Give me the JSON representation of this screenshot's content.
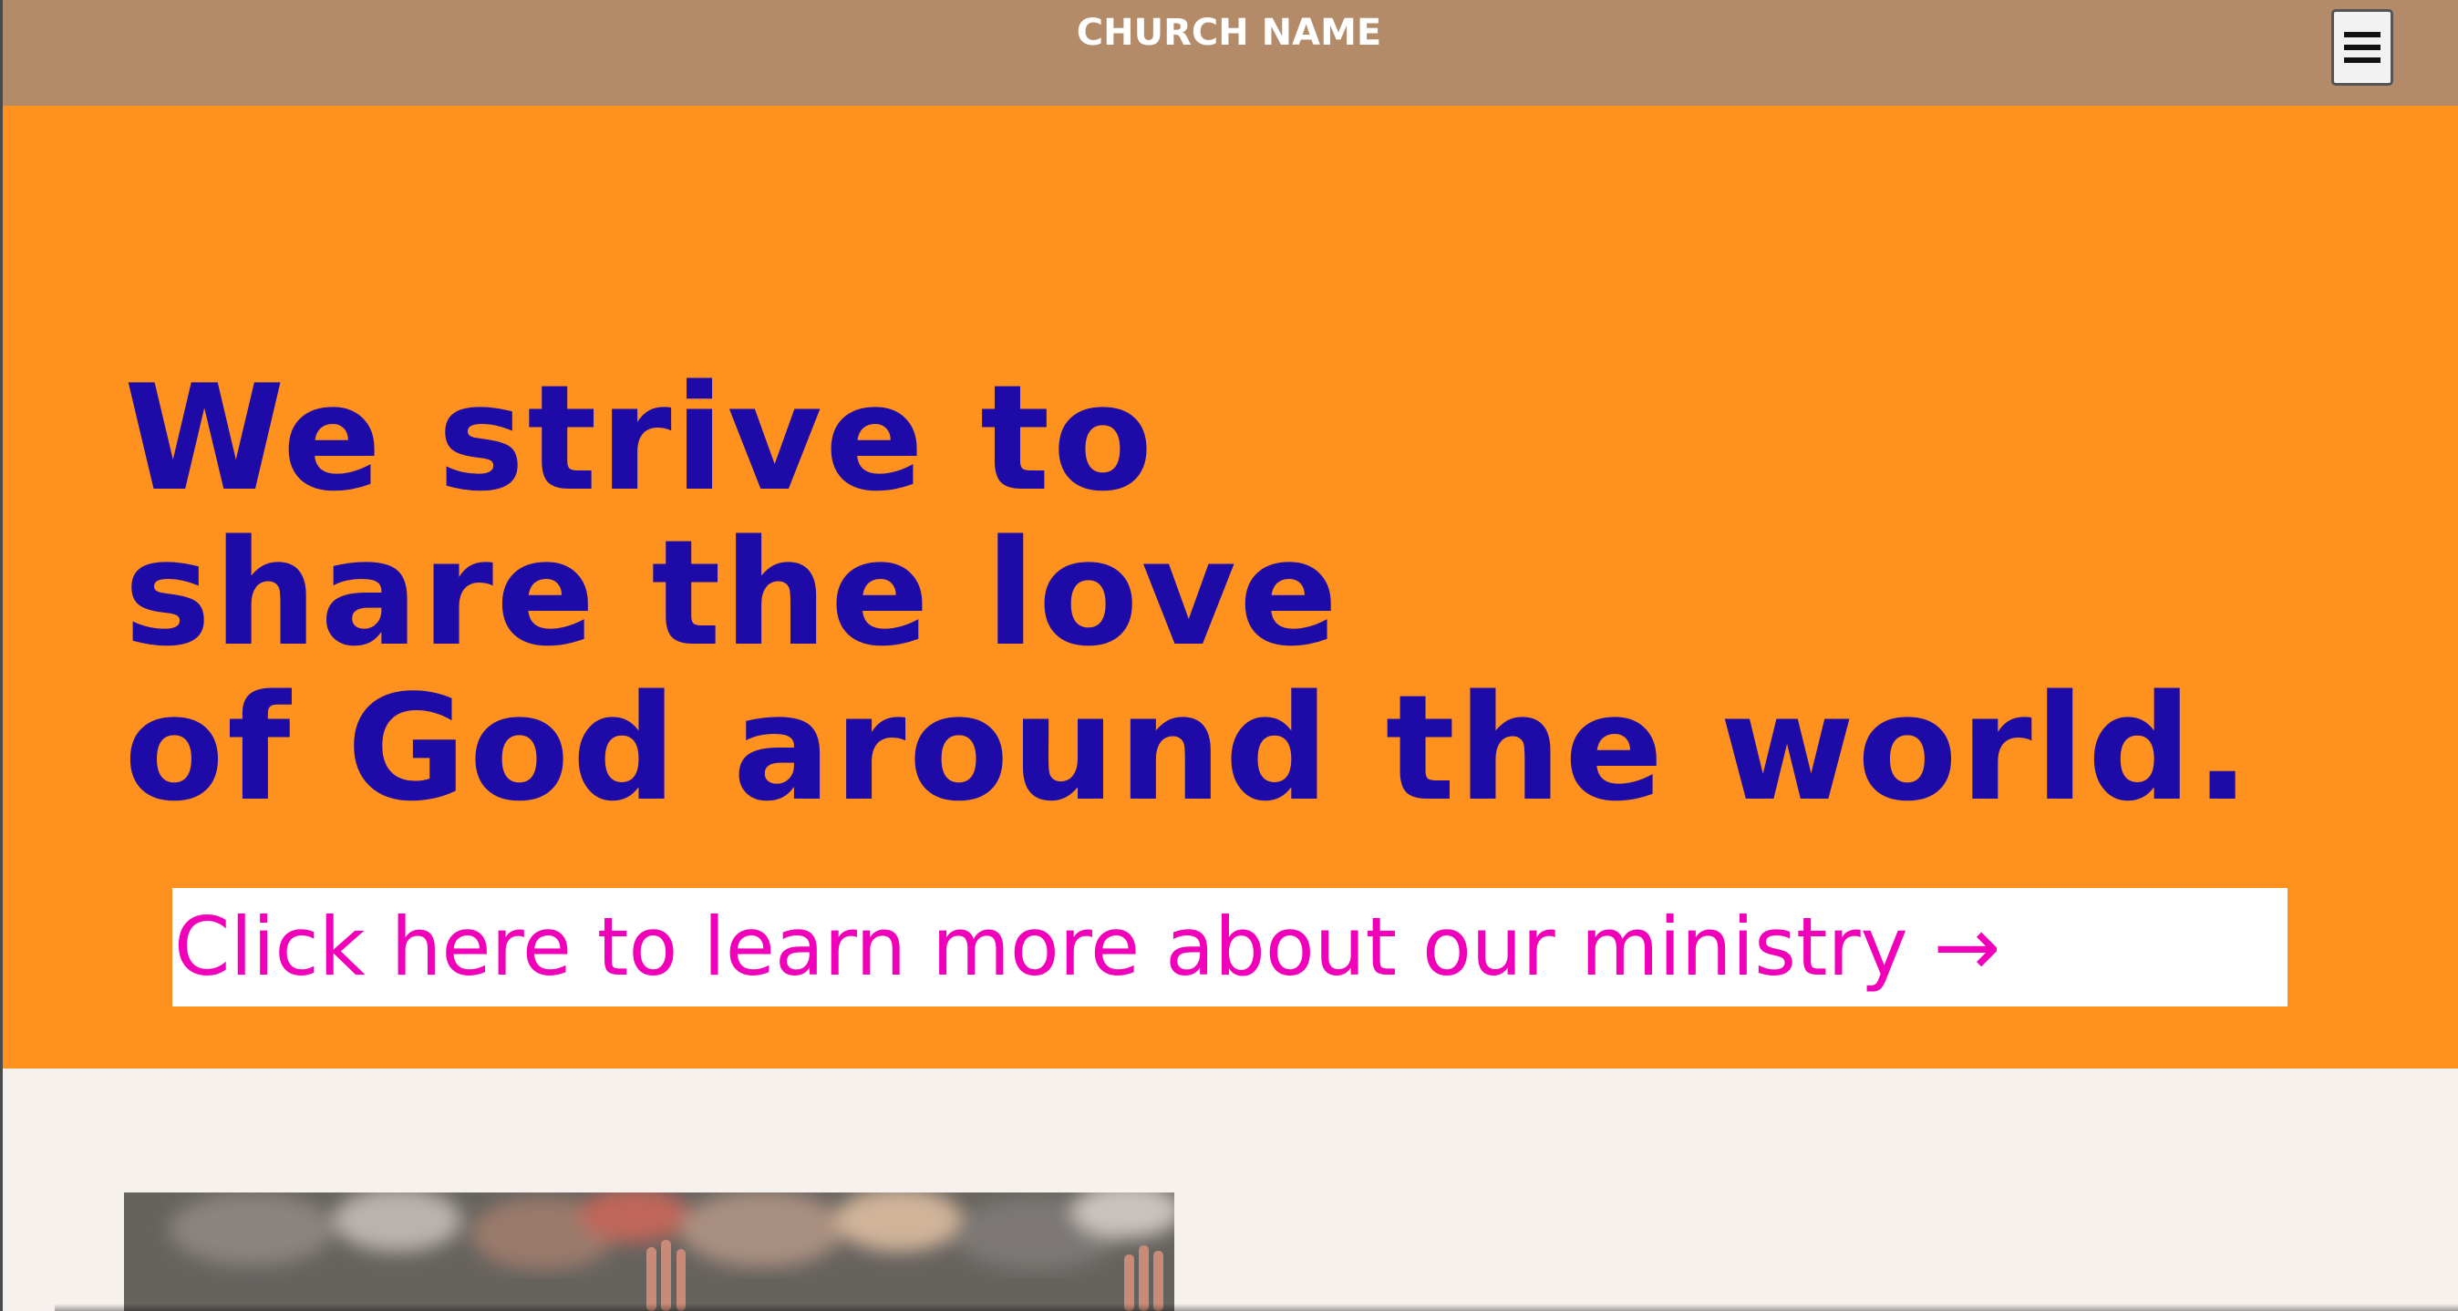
{
  "header": {
    "brand": "CHURCH NAME",
    "menu_icon": "hamburger-menu-icon"
  },
  "hero": {
    "headline_lines": [
      "We strive to",
      "share the love",
      "of God around the world."
    ],
    "cta_label": "Click here to learn more about our ministry →"
  },
  "colors": {
    "header_bg": "#b38b69",
    "hero_bg": "#ff911f",
    "headline": "#1e0aa6",
    "cta_text": "#f000b8",
    "cta_bg": "#ffffff",
    "section_bg": "#f7f1ee"
  },
  "content": {
    "photo_subject": "crowd with raised hands"
  }
}
